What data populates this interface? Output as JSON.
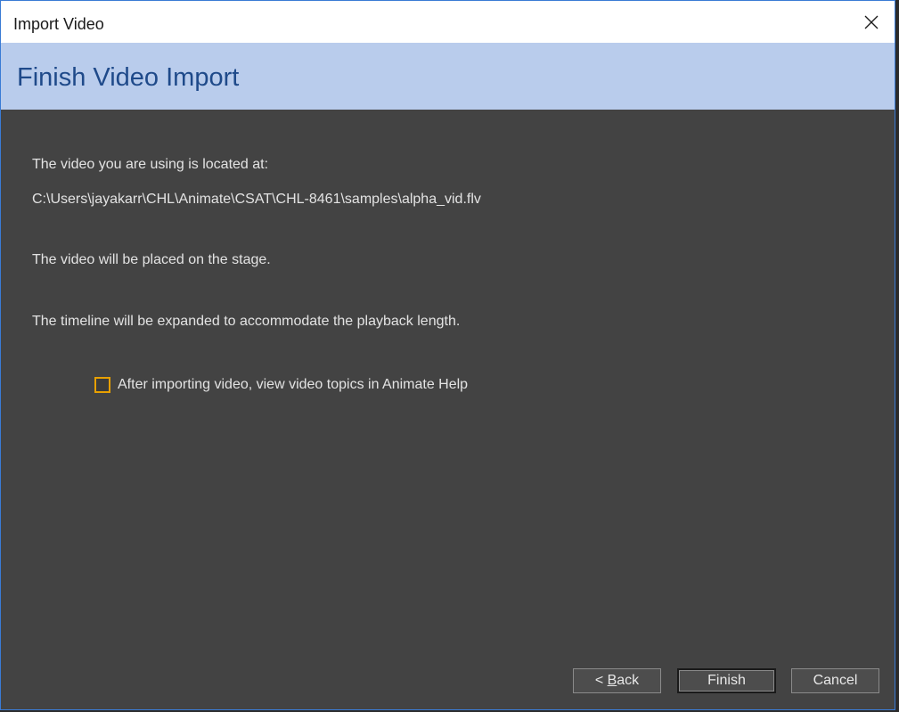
{
  "window": {
    "title": "Import Video",
    "close_icon": "close-icon"
  },
  "header": {
    "title": "Finish Video Import"
  },
  "content": {
    "location_label": "The video you are using is located at:",
    "location_path": "C:\\Users\\jayakarr\\CHL\\Animate\\CSAT\\CHL-8461\\samples\\alpha_vid.flv",
    "placement_text": "The video will be placed on the stage.",
    "timeline_text": "The timeline will be expanded to accommodate the playback length.",
    "help_checkbox": {
      "label": "After importing video, view video topics in Animate Help",
      "checked": false
    }
  },
  "buttons": {
    "back_prefix": "< ",
    "back_label": "Back",
    "finish_label": "Finish",
    "cancel_label": "Cancel"
  },
  "colors": {
    "header_band": "#b9ccec",
    "header_title": "#1f4a8a",
    "content_bg": "#434343",
    "checkbox_border": "#e8a000"
  }
}
